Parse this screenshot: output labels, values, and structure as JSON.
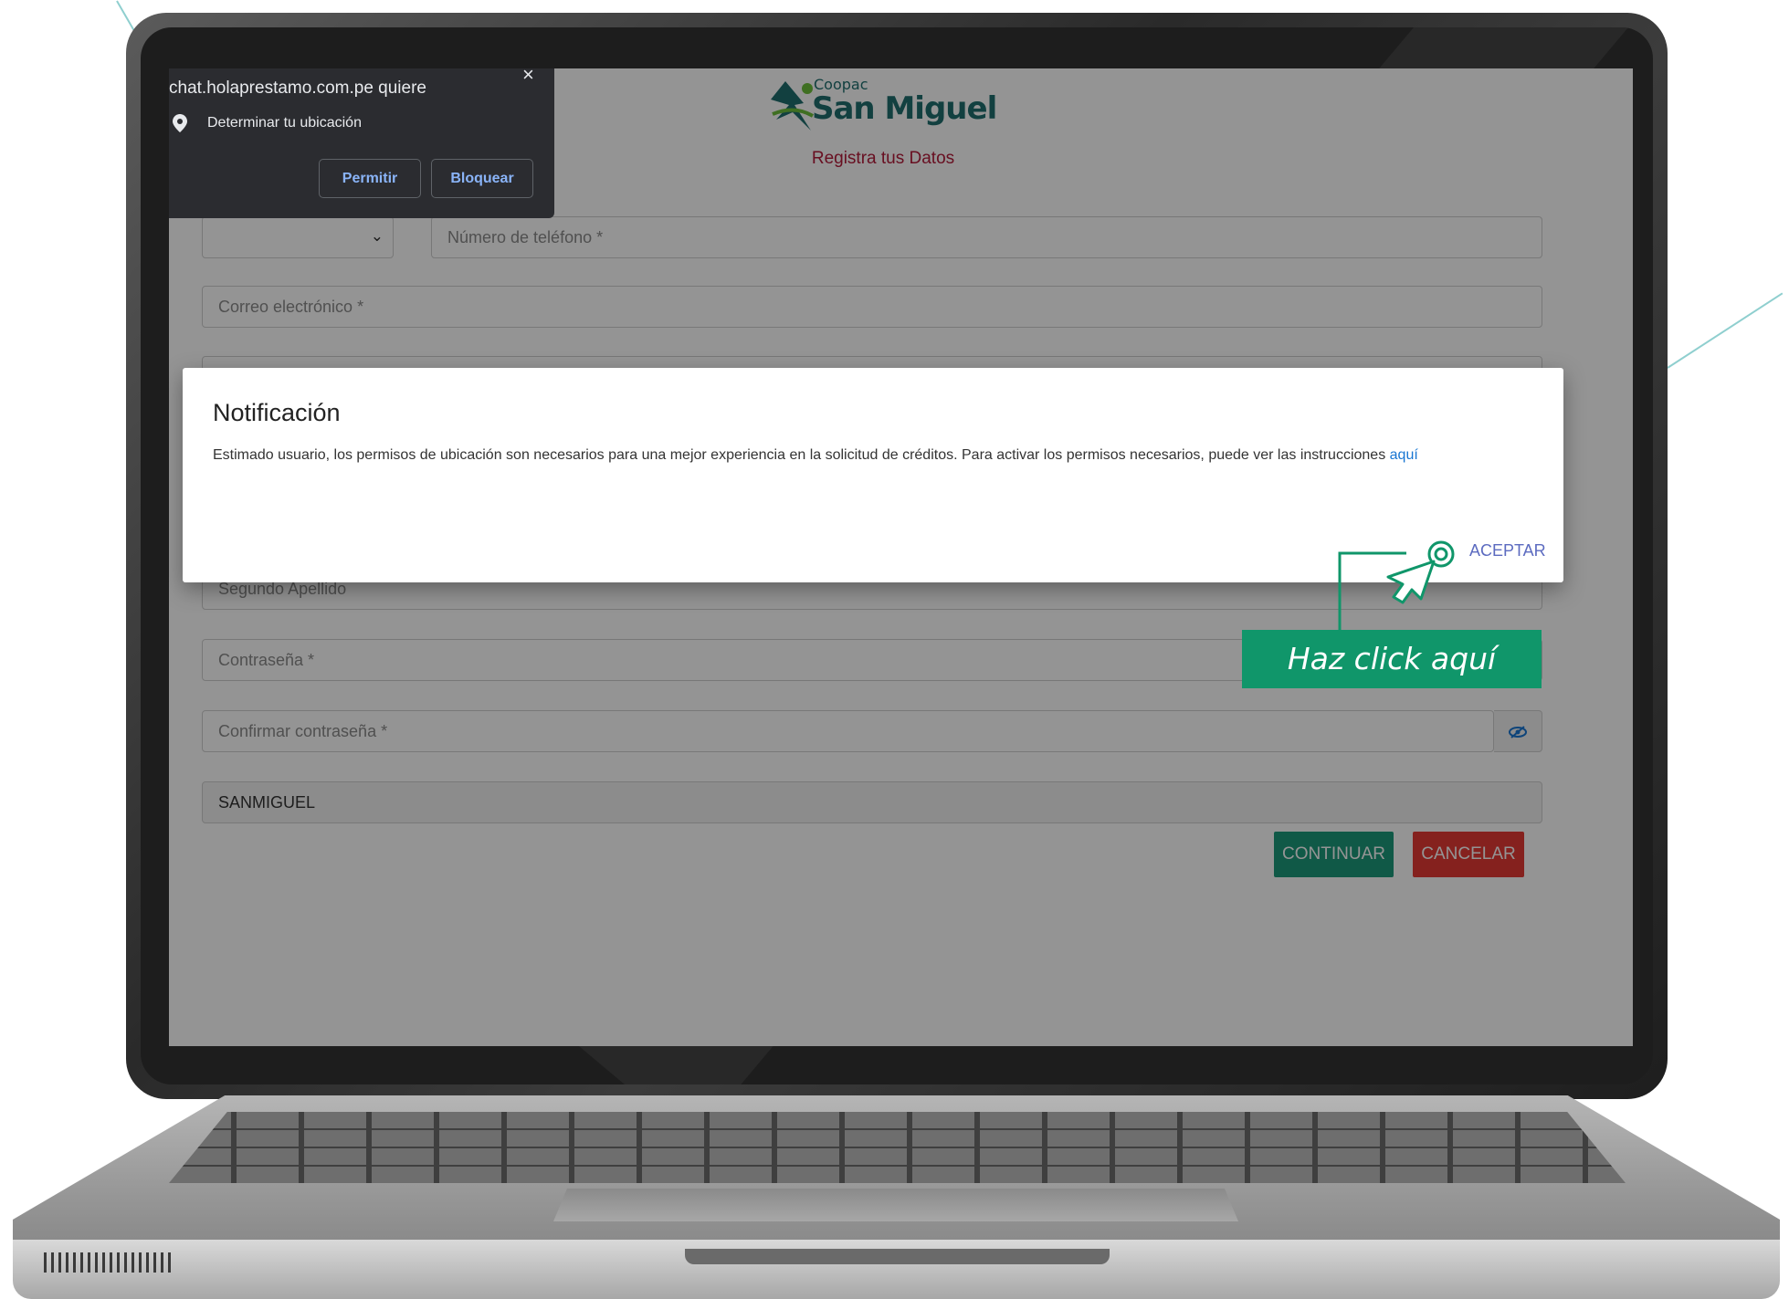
{
  "browser_prompt": {
    "site_text": "chat.holaprestamo.com.pe quiere",
    "permission_text": "Determinar tu ubicación",
    "allow_label": "Permitir",
    "block_label": "Bloquear",
    "close_glyph": "×",
    "pin_icon": "location-pin-icon"
  },
  "header": {
    "logo_small": "Coopac",
    "logo_name": "San Miguel",
    "subtitle": "Registra tus Datos"
  },
  "form": {
    "phone_placeholder": "Número de teléfono *",
    "email_placeholder": "Correo electrónico *",
    "second_surname_placeholder": "Segundo Apellido",
    "password_placeholder": "Contraseña *",
    "confirm_password_placeholder": "Confirmar contraseña *",
    "code_value": "SANMIGUEL",
    "chevron": "⌄",
    "eye_icon": "eye-slash-icon"
  },
  "buttons": {
    "continue_label": "CONTINUAR",
    "cancel_label": "CANCELAR"
  },
  "modal": {
    "title": "Notificación",
    "body": "Estimado usuario, los permisos de ubicación son necesarios para una mejor experiencia en la solicitud de créditos. Para activar los permisos necesarios, puede ver las instrucciones ",
    "link_text": "aquí",
    "accept_label": "ACEPTAR"
  },
  "callout": {
    "text": "Haz click aquí"
  },
  "colors": {
    "brand_green": "#10966a",
    "brand_teal": "#1f6f6f",
    "continue_green": "#1c9a7a",
    "cancel_red": "#e53935",
    "subtitle_red": "#b31b3a"
  }
}
